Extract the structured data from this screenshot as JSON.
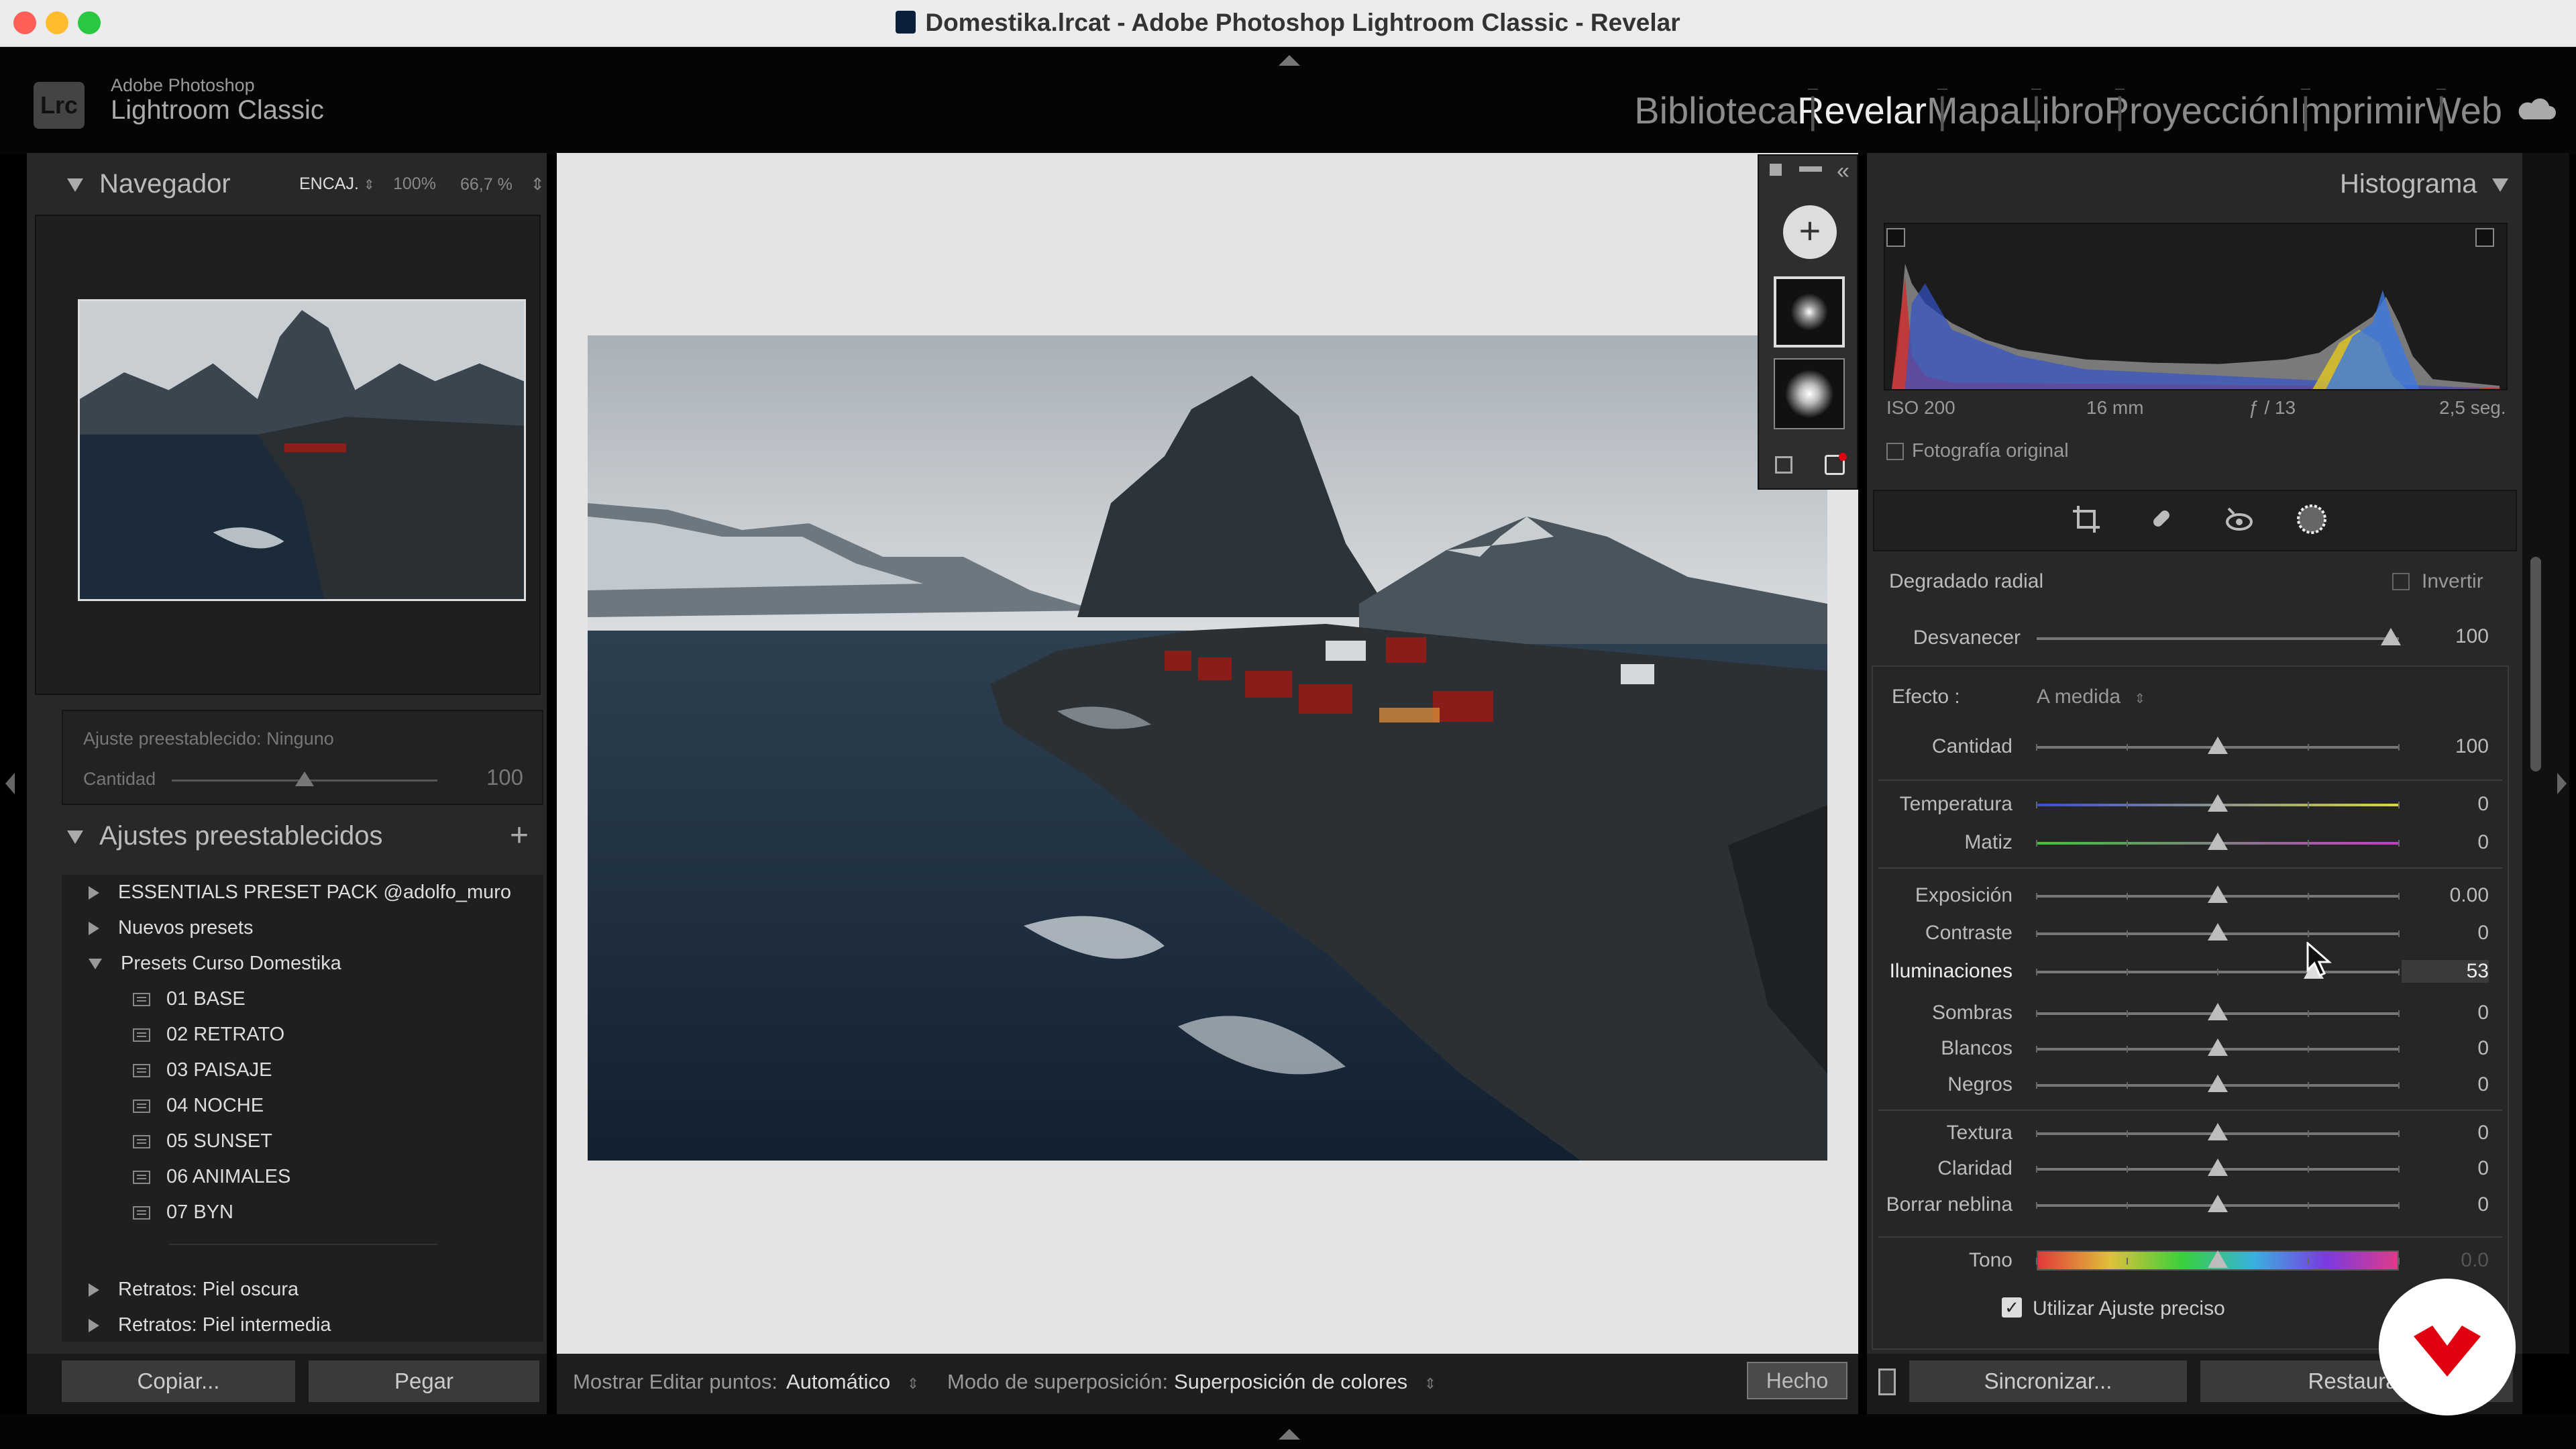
{
  "window": {
    "title": "Domestika.lrcat - Adobe Photoshop Lightroom Classic - Revelar"
  },
  "brand": {
    "line1": "Adobe Photoshop",
    "line2": "Lightroom Classic",
    "logo": "Lrc"
  },
  "modules": {
    "m1": "Biblioteca",
    "m2": "Revelar",
    "m3": "Mapa",
    "m4": "Libro",
    "m5": "Proyección",
    "m6": "Imprimir",
    "m7": "Web"
  },
  "navigator": {
    "title": "Navegador",
    "fit": "ENCAJ.",
    "z1": "100%",
    "z2": "66,7 %"
  },
  "adjustment": {
    "label": "Ajuste preestablecido: Ninguno",
    "amount_label": "Cantidad",
    "amount_value": "100",
    "amount_fraction": 0.5
  },
  "presets": {
    "title": "Ajustes preestablecidos",
    "groups": {
      "g1": "ESSENTIALS PRESET PACK @adolfo_muro",
      "g2": "Nuevos presets",
      "g3": "Presets Curso Domestika",
      "g4": "Retratos: Piel oscura",
      "g5": "Retratos: Piel intermedia"
    },
    "items": [
      "01 BASE",
      "02 RETRATO",
      "03 PAISAJE",
      "04 NOCHE",
      "05 SUNSET",
      "06 ANIMALES",
      "07 BYN"
    ]
  },
  "leftbuttons": {
    "copy": "Copiar...",
    "paste": "Pegar"
  },
  "toolbar": {
    "show_label": "Mostrar Editar puntos:",
    "show_value": "Automático",
    "overlay_label": "Modo de superposición:",
    "overlay_value": "Superposición de colores",
    "done": "Hecho"
  },
  "histogram": {
    "title": "Histograma",
    "iso": "ISO 200",
    "focal": "16 mm",
    "aperture": "ƒ / 13",
    "shutter": "2,5 seg.",
    "original": "Fotografía original"
  },
  "mask": {
    "type": "Degradado radial",
    "invert": "Invertir",
    "feather_label": "Desvanecer",
    "feather_value": "100"
  },
  "effect": {
    "label": "Efecto :",
    "preset": "A medida"
  },
  "sliders": [
    {
      "label": "Cantidad",
      "value": "100",
      "pos": 0.5
    },
    {
      "label": "Temperatura",
      "value": "0",
      "pos": 0.5
    },
    {
      "label": "Matiz",
      "value": "0",
      "pos": 0.5
    },
    {
      "label": "Exposición",
      "value": "0.00",
      "pos": 0.5
    },
    {
      "label": "Contraste",
      "value": "0",
      "pos": 0.5
    },
    {
      "label": "Iluminaciones",
      "value": "53",
      "pos": 0.765
    },
    {
      "label": "Sombras",
      "value": "0",
      "pos": 0.5
    },
    {
      "label": "Blancos",
      "value": "0",
      "pos": 0.5
    },
    {
      "label": "Negros",
      "value": "0",
      "pos": 0.5
    },
    {
      "label": "Textura",
      "value": "0",
      "pos": 0.5
    },
    {
      "label": "Claridad",
      "value": "0",
      "pos": 0.5
    },
    {
      "label": "Borrar neblina",
      "value": "0",
      "pos": 0.5
    },
    {
      "label": "Tono",
      "value": "0.0",
      "pos": 0.5
    }
  ],
  "fine_adjust": "Utilizar Ajuste preciso",
  "rightbuttons": {
    "sync": "Sincronizar...",
    "reset": "Restaurar"
  },
  "colors": {
    "accent": "#e0000f",
    "panel": "#282828",
    "canvas": "#e4e4e4"
  }
}
